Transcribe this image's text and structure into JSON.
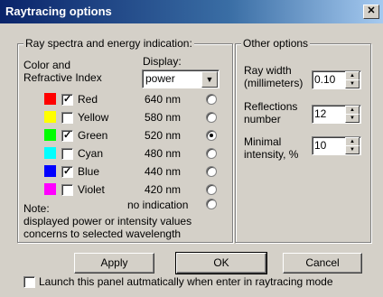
{
  "window": {
    "title": "Raytracing options",
    "close_glyph": "✕"
  },
  "ray": {
    "legend": "Ray spectra and energy indication:",
    "color_label_1": "Color and",
    "color_label_2": "Refractive Index",
    "display_label": "Display:",
    "display_value": "power",
    "colors": [
      {
        "name": "Red",
        "nm": "640 nm",
        "swatch": "#ff0000",
        "checked": true,
        "selected": false
      },
      {
        "name": "Yellow",
        "nm": "580 nm",
        "swatch": "#ffff00",
        "checked": false,
        "selected": false
      },
      {
        "name": "Green",
        "nm": "520 nm",
        "swatch": "#00ff00",
        "checked": true,
        "selected": true
      },
      {
        "name": "Cyan",
        "nm": "480 nm",
        "swatch": "#00ffff",
        "checked": false,
        "selected": false
      },
      {
        "name": "Blue",
        "nm": "440 nm",
        "swatch": "#0000ff",
        "checked": true,
        "selected": false
      },
      {
        "name": "Violet",
        "nm": "420 nm",
        "swatch": "#ff00ff",
        "checked": false,
        "selected": false
      }
    ],
    "no_indication": "no indication",
    "note_1": "Note:",
    "note_2": "displayed power or intensity values",
    "note_3": "concerns to selected wavelength"
  },
  "other": {
    "legend": "Other options",
    "ray_width_1": "Ray width",
    "ray_width_2": "(millimeters)",
    "ray_width_value": "0.10",
    "reflections_1": "Reflections",
    "reflections_2": "number",
    "reflections_value": "12",
    "min_int_1": "Minimal",
    "min_int_2": "intensity, %",
    "min_int_value": "10"
  },
  "buttons": {
    "apply": "Apply",
    "ok": "OK",
    "cancel": "Cancel"
  },
  "launch": {
    "label": "Launch this panel autmatically when enter in raytracing mode",
    "checked": false
  }
}
